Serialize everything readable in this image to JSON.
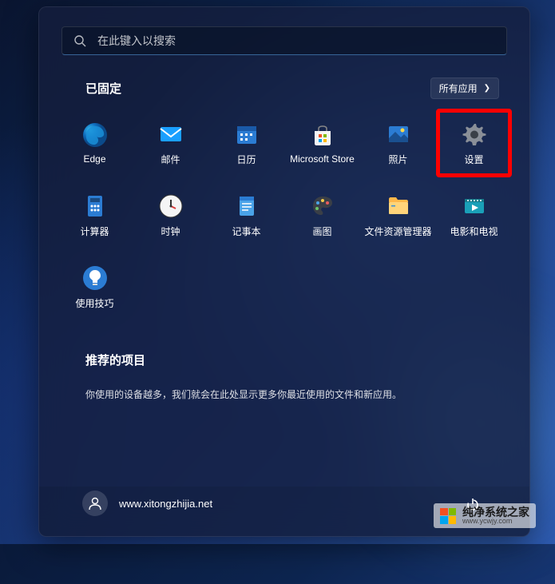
{
  "search": {
    "placeholder": "在此键入以搜索"
  },
  "pinned": {
    "title": "已固定",
    "all_apps_label": "所有应用",
    "apps": [
      {
        "label": "Edge",
        "icon": "edge"
      },
      {
        "label": "邮件",
        "icon": "mail"
      },
      {
        "label": "日历",
        "icon": "calendar"
      },
      {
        "label": "Microsoft Store",
        "icon": "store"
      },
      {
        "label": "照片",
        "icon": "photos"
      },
      {
        "label": "设置",
        "icon": "settings",
        "highlighted": true
      },
      {
        "label": "计算器",
        "icon": "calculator"
      },
      {
        "label": "时钟",
        "icon": "clock"
      },
      {
        "label": "记事本",
        "icon": "notepad"
      },
      {
        "label": "画图",
        "icon": "paint"
      },
      {
        "label": "文件资源管理器",
        "icon": "explorer"
      },
      {
        "label": "电影和电视",
        "icon": "movies"
      },
      {
        "label": "使用技巧",
        "icon": "tips"
      }
    ]
  },
  "recommended": {
    "title": "推荐的项目",
    "description": "你使用的设备越多，我们就会在此处显示更多你最近使用的文件和新应用。"
  },
  "footer": {
    "user_name": "www.xitongzhijia.net"
  },
  "watermark": {
    "main": "纯净系统之家",
    "sub": "www.ycwjy.com"
  }
}
